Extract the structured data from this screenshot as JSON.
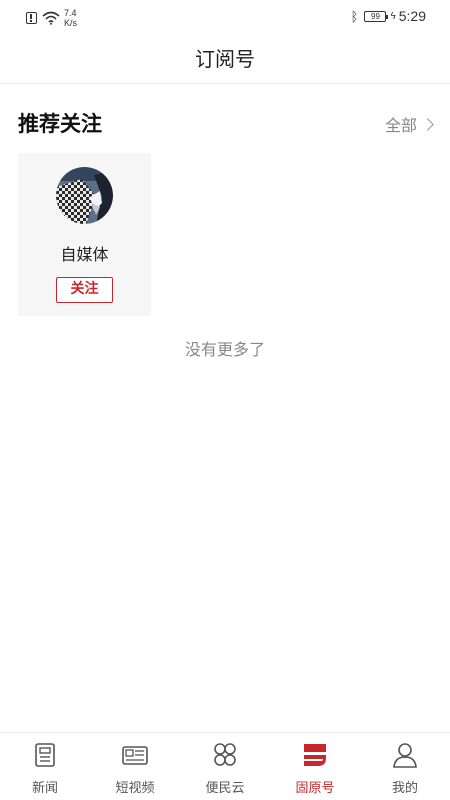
{
  "status_bar": {
    "speed_value": "7.4",
    "speed_unit": "K/s",
    "battery": "99",
    "time": "5:29"
  },
  "header": {
    "title": "订阅号"
  },
  "section": {
    "title": "推荐关注",
    "more_label": "全部"
  },
  "cards": [
    {
      "name": "自媒体",
      "follow_label": "关注"
    }
  ],
  "footer_text": "没有更多了",
  "nav": {
    "items": [
      {
        "label": "新闻",
        "icon": "news-icon",
        "active": false
      },
      {
        "label": "短视频",
        "icon": "video-icon",
        "active": false
      },
      {
        "label": "便民云",
        "icon": "grid-icon",
        "active": false
      },
      {
        "label": "固原号",
        "icon": "brand-icon",
        "active": true
      },
      {
        "label": "我的",
        "icon": "user-icon",
        "active": false
      }
    ]
  },
  "colors": {
    "accent": "#c8282d",
    "text": "#222222",
    "muted": "#888888"
  }
}
